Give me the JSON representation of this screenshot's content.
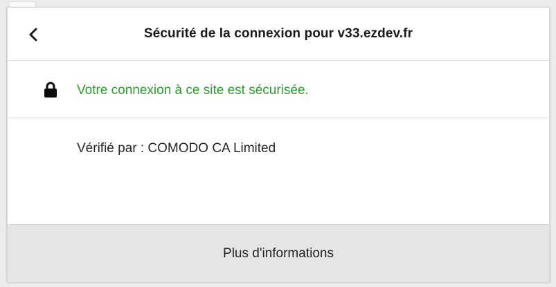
{
  "panel": {
    "title": "Sécurité de la connexion pour v33.ezdev.fr",
    "back_icon": "chevron-left-icon"
  },
  "connection": {
    "icon": "lock-icon",
    "status_text": "Votre connexion à ce site est sécurisée.",
    "status_color": "#2b9c2b"
  },
  "certificate": {
    "verified_by": "Vérifié par : COMODO CA Limited"
  },
  "footer": {
    "more_info_label": "Plus d'informations"
  }
}
